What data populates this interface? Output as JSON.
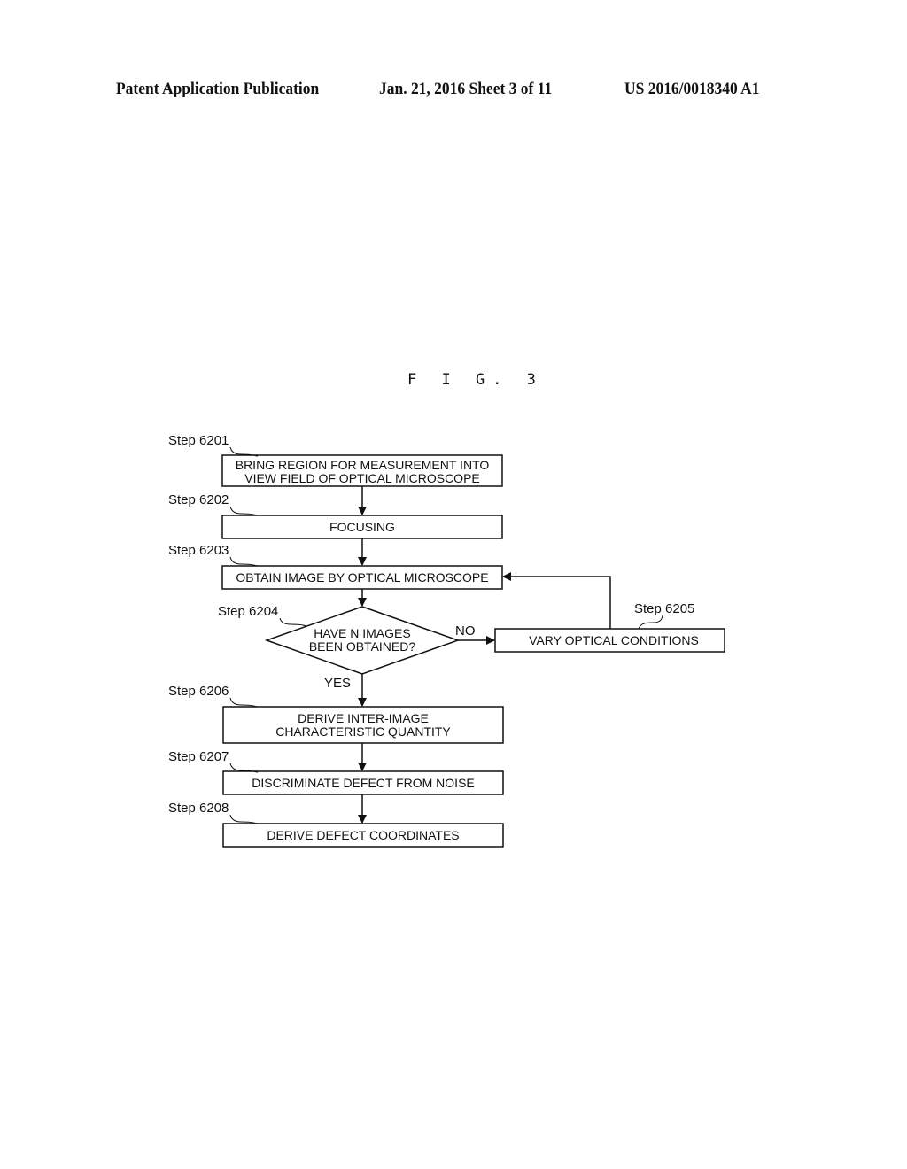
{
  "header": {
    "left": "Patent Application Publication",
    "center": "Jan. 21, 2016  Sheet 3 of 11",
    "right": "US 2016/0018340 A1"
  },
  "figure": {
    "title": "F I G. 3"
  },
  "steps": [
    {
      "id": "Step 6201",
      "lines": [
        "BRING REGION FOR MEASUREMENT INTO",
        "VIEW FIELD OF OPTICAL MICROSCOPE"
      ]
    },
    {
      "id": "Step 6202",
      "lines": [
        "FOCUSING"
      ]
    },
    {
      "id": "Step 6203",
      "lines": [
        "OBTAIN IMAGE BY OPTICAL MICROSCOPE"
      ]
    },
    {
      "id": "Step 6204",
      "lines": [
        "HAVE N IMAGES",
        "BEEN OBTAINED?"
      ]
    },
    {
      "id": "Step 6205",
      "lines": [
        "VARY OPTICAL CONDITIONS"
      ]
    },
    {
      "id": "Step 6206",
      "lines": [
        "DERIVE INTER-IMAGE",
        "CHARACTERISTIC QUANTITY"
      ]
    },
    {
      "id": "Step 6207",
      "lines": [
        "DISCRIMINATE DEFECT FROM NOISE"
      ]
    },
    {
      "id": "Step 6208",
      "lines": [
        "DERIVE DEFECT COORDINATES"
      ]
    }
  ],
  "edges": {
    "no_label": "NO",
    "yes_label": "YES"
  }
}
